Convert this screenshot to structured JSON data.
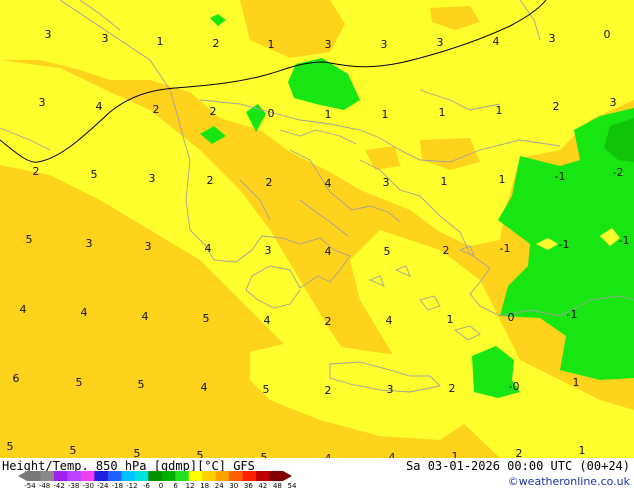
{
  "map": {
    "contour_labels": [
      {
        "text": "3"
      },
      {
        "text": "3"
      },
      {
        "text": "1"
      },
      {
        "text": "2"
      },
      {
        "text": "1"
      },
      {
        "text": "3"
      },
      {
        "text": "3"
      },
      {
        "text": "3"
      },
      {
        "text": "4"
      },
      {
        "text": "3"
      },
      {
        "text": "0"
      },
      {
        "text": "3"
      },
      {
        "text": "4"
      },
      {
        "text": "2"
      },
      {
        "text": "2"
      },
      {
        "text": "0"
      },
      {
        "text": "1"
      },
      {
        "text": "1"
      },
      {
        "text": "1"
      },
      {
        "text": "1"
      },
      {
        "text": "2"
      },
      {
        "text": "3"
      },
      {
        "text": "2"
      },
      {
        "text": "5"
      },
      {
        "text": "3"
      },
      {
        "text": "2"
      },
      {
        "text": "2"
      },
      {
        "text": "4"
      },
      {
        "text": "3"
      },
      {
        "text": "1"
      },
      {
        "text": "1"
      },
      {
        "text": "-1"
      },
      {
        "text": "-2"
      },
      {
        "text": "5"
      },
      {
        "text": "3"
      },
      {
        "text": "3"
      },
      {
        "text": "4"
      },
      {
        "text": "3"
      },
      {
        "text": "4"
      },
      {
        "text": "5"
      },
      {
        "text": "2"
      },
      {
        "text": "-1"
      },
      {
        "text": "-1"
      },
      {
        "text": "-1"
      },
      {
        "text": "4"
      },
      {
        "text": "4"
      },
      {
        "text": "4"
      },
      {
        "text": "5"
      },
      {
        "text": "4"
      },
      {
        "text": "2"
      },
      {
        "text": "4"
      },
      {
        "text": "1"
      },
      {
        "text": "0"
      },
      {
        "text": "-1"
      },
      {
        "text": "6"
      },
      {
        "text": "5"
      },
      {
        "text": "5"
      },
      {
        "text": "4"
      },
      {
        "text": "5"
      },
      {
        "text": "2"
      },
      {
        "text": "3"
      },
      {
        "text": "2"
      },
      {
        "text": "-0"
      },
      {
        "text": "1"
      },
      {
        "text": "5"
      },
      {
        "text": "5"
      },
      {
        "text": "5"
      },
      {
        "text": "5"
      },
      {
        "text": "5"
      },
      {
        "text": "4"
      },
      {
        "text": "4"
      },
      {
        "text": "1"
      },
      {
        "text": "2"
      },
      {
        "text": "1"
      }
    ],
    "colors": {
      "yellow": "#ffff2e",
      "gold": "#ffd21c",
      "green": "#17e612",
      "dark_green": "#10c40c",
      "contour": "#000000",
      "coast": "#a0a0a0"
    }
  },
  "footer": {
    "title": "Height/Temp. 850 hPa [gdmp][°C] GFS",
    "datetime": "Sa 03-01-2026 00:00 UTC (00+24)",
    "credit": "©weatheronline.co.uk",
    "scale_ticks": [
      "-54",
      "-48",
      "-42",
      "-38",
      "-30",
      "-24",
      "-18",
      "-12",
      "-6",
      "0",
      "6",
      "12",
      "18",
      "24",
      "30",
      "36",
      "42",
      "48",
      "54"
    ],
    "scale_colors": [
      "#777777",
      "#8a8a8a",
      "#a020f0",
      "#c040ff",
      "#ee40ee",
      "#2020e0",
      "#2060ff",
      "#00c0ff",
      "#00e0e0",
      "#009000",
      "#00b000",
      "#20e020",
      "#ffff00",
      "#ffd000",
      "#ffa000",
      "#ff6000",
      "#ff2000",
      "#c00000",
      "#800000"
    ]
  }
}
